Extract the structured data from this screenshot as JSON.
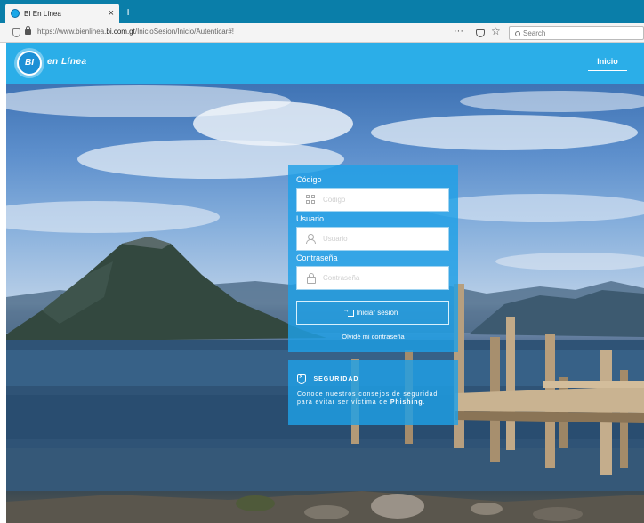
{
  "browser": {
    "tab_title": "BI En Línea",
    "tab_close": "×",
    "new_tab": "+",
    "url_prefix": "https://www.bienlinea.",
    "url_domain": "bi.com.gt",
    "url_path": "/InicioSesion/Inicio/Autenticar#!",
    "more_menu": "···",
    "bookmark_star": "☆",
    "search_placeholder": "Search"
  },
  "header": {
    "logo_mark": "BI",
    "logo_text": "en Línea",
    "nav_inicio": "Inicio",
    "brand_color": "#2baee8"
  },
  "login": {
    "codigo_label": "Código",
    "codigo_placeholder": "Código",
    "usuario_label": "Usuario",
    "usuario_placeholder": "Usuario",
    "password_label": "Contraseña",
    "password_placeholder": "Contraseña",
    "submit_label": "Iniciar sesión",
    "forgot_label": "Olvidé mi contraseña"
  },
  "security": {
    "title": "SEGURIDAD",
    "text_before": "Conoce nuestros consejos de seguridad para evitar ser víctima de ",
    "text_bold": "Phishing",
    "text_after": "."
  }
}
